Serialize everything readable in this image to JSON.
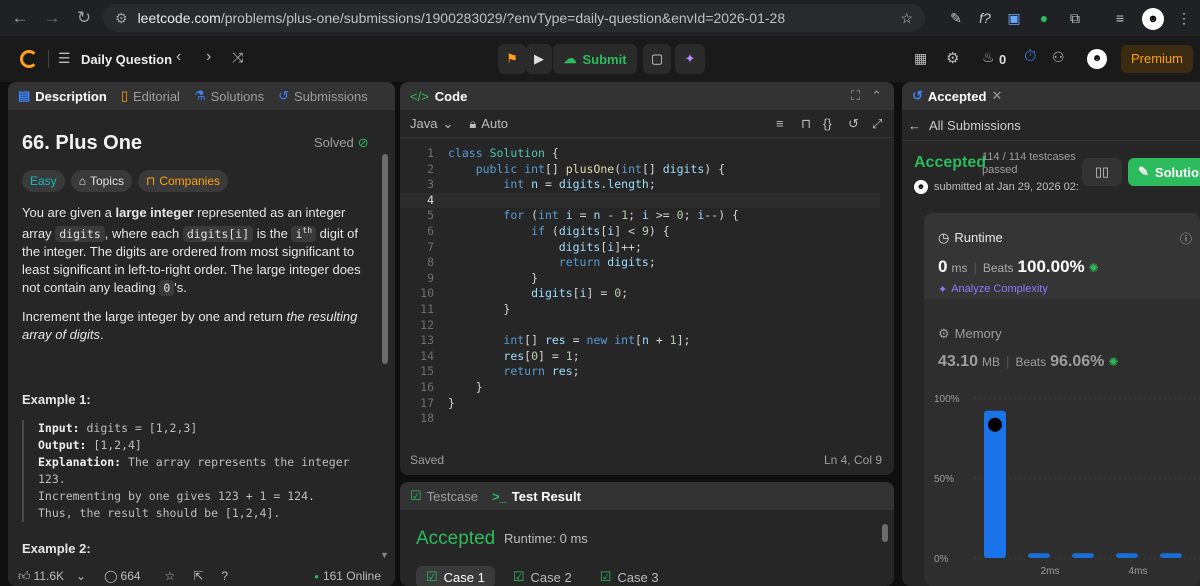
{
  "browser": {
    "url_host": "leetcode.com",
    "url_path": "/problems/plus-one/submissions/1900283029/?envType=daily-question&envId=2026-01-28"
  },
  "nav": {
    "daily_label": "Daily Question",
    "submit_label": "Submit",
    "streak_count": "0",
    "premium_label": "Premium"
  },
  "left": {
    "tabs": [
      "Description",
      "Editorial",
      "Solutions",
      "Submissions"
    ],
    "title": "66. Plus One",
    "solved_label": "Solved",
    "tags": [
      "Easy",
      "Topics",
      "Companies"
    ],
    "desc1_a": "You are given a ",
    "desc1_b": "large integer",
    "desc1_c": " represented as an integer array ",
    "desc1_code1": "digits",
    "desc1_d": ", where each ",
    "desc1_code2": "digits[i]",
    "desc1_e": " is the ",
    "desc1_sup_i": "i",
    "desc1_sup": "th",
    "desc1_f": " digit of the integer. The digits are ordered from most significant to least significant in left-to-right order. The large integer does not contain any leading ",
    "desc1_code3": "0",
    "desc1_g": "'s.",
    "desc2_a": "Increment the large integer by one and return ",
    "desc2_b": "the resulting array of digits",
    "desc2_c": ".",
    "example1_title": "Example 1:",
    "ex1_input_label": "Input:",
    "ex1_input": " digits = [1,2,3]",
    "ex1_output_label": "Output:",
    "ex1_output": " [1,2,4]",
    "ex1_expl_label": "Explanation:",
    "ex1_expl": " The array represents the integer",
    "ex1_expl2": "123.",
    "ex1_expl3": "Incrementing by one gives 123 + 1 = 124.",
    "ex1_expl4": "Thus, the result should be [1,2,4].",
    "example2_title": "Example 2:",
    "likes": "11.6K",
    "comments": "664",
    "online": "161 Online"
  },
  "code": {
    "tab_label": "Code",
    "language": "Java",
    "auto_label": "Auto",
    "status_saved": "Saved",
    "cursor": "Ln 4, Col 9"
  },
  "testpanel": {
    "tab_testcase": "Testcase",
    "tab_result": "Test Result",
    "accepted": "Accepted",
    "runtime": "Runtime: 0 ms",
    "cases": [
      "Case 1",
      "Case 2",
      "Case 3"
    ]
  },
  "right": {
    "tab_label": "Accepted",
    "all_submissions": "All Submissions",
    "accepted": "Accepted",
    "testcases": "114 / 114 testcases",
    "passed": "passed",
    "submitted": "submitted at Jan 29, 2026 02:",
    "solution_btn": "Solution",
    "runtime_title": "Runtime",
    "runtime_value": "0",
    "runtime_unit": "ms",
    "beats_label": "Beats",
    "runtime_beats": "100.00%",
    "analyze": "Analyze Complexity",
    "memory_title": "Memory",
    "memory_value": "43.10",
    "memory_unit": "MB",
    "memory_beats": "96.06%"
  },
  "chart_data": {
    "type": "bar",
    "y_tick_labels": [
      "100%",
      "50%",
      "0%"
    ],
    "x_tick_labels": [
      "2ms",
      "4ms"
    ],
    "values": [
      92,
      3,
      3,
      3,
      3
    ],
    "ylim": [
      0,
      100
    ],
    "highlight_index": 0
  },
  "colors": {
    "accent_green": "#2cbb5d",
    "bar_blue": "#1a73e8",
    "premium": "#ffa116"
  }
}
